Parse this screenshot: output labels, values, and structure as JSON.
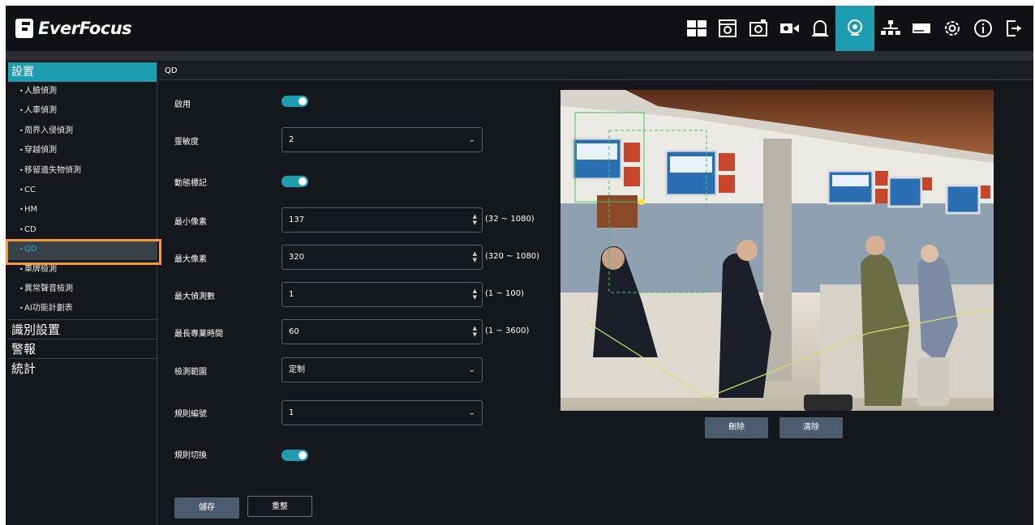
{
  "app": {
    "brand": "EverFocus"
  },
  "toolbar": {
    "icons": [
      "layout-icon",
      "playback-icon",
      "snapshot-icon",
      "record-icon",
      "alarm-icon",
      "ai-icon",
      "network-icon",
      "storage-icon",
      "settings-icon",
      "info-icon",
      "logout-icon"
    ],
    "active": "ai-icon",
    "accent_color": "#1e9cb0"
  },
  "sidebar": {
    "settings_head": "設置",
    "items": [
      {
        "label": "人臉偵測"
      },
      {
        "label": "人車偵測"
      },
      {
        "label": "周界入侵偵測"
      },
      {
        "label": "穿越偵測"
      },
      {
        "label": "移留遺失物偵測"
      },
      {
        "label": "CC"
      },
      {
        "label": "HM"
      },
      {
        "label": "CD"
      },
      {
        "label": "QD",
        "selected": true
      },
      {
        "label": "車牌檢測"
      },
      {
        "label": "異常聲音檢測"
      },
      {
        "label": "AI功能計劃表"
      }
    ],
    "categories": [
      "識別設置",
      "警報",
      "統計"
    ]
  },
  "content": {
    "title": "QD",
    "enable_label": "啟用",
    "sensitivity_label": "靈敏度",
    "sensitivity_value": "2",
    "motion_mark_label": "動態標記",
    "min_pixels_label": "最小像素",
    "min_pixels_value": "137",
    "min_pixels_range": "(32 ~ 1080)",
    "max_pixels_label": "最大像素",
    "max_pixels_value": "320",
    "max_pixels_range": "(320 ~ 1080)",
    "max_detect_label": "最大偵測數",
    "max_detect_value": "1",
    "max_detect_range": "(1 ~ 100)",
    "max_time_label": "最長專業時間",
    "max_time_value": "60",
    "max_time_range": "(1 ~ 3600)",
    "detect_area_label": "檢測範圍",
    "detect_area_value": "定制",
    "rule_no_label": "規則編號",
    "rule_no_value": "1",
    "rule_switch_label": "規則切換",
    "delete_label": "刪除",
    "clear_label": "清除",
    "save_label": "儲存",
    "reset_label": "重整",
    "enable_on": true,
    "motion_mark_on": true,
    "rule_switch_on": true
  }
}
